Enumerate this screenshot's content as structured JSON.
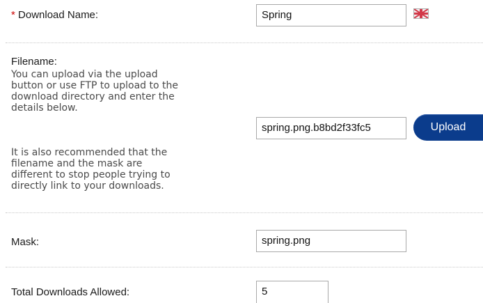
{
  "download_name": {
    "required_marker": "*",
    "label": "Download Name:",
    "value": "Spring",
    "language_icon": "uk-flag-icon"
  },
  "filename": {
    "label": "Filename:",
    "help_1_lines": [
      "You can upload via the upload",
      "button or use FTP to upload to the",
      "download directory and enter the",
      "details below."
    ],
    "help_2_lines": [
      "It is also recommended that the",
      "filename and the mask are",
      "different to stop people trying to",
      "directly link to your downloads."
    ],
    "value": "spring.png.b8bd2f33fc5",
    "upload_label": "Upload"
  },
  "mask": {
    "label": "Mask:",
    "value": "spring.png"
  },
  "total_downloads": {
    "label": "Total Downloads Allowed:",
    "value": "5"
  },
  "colors": {
    "required": "#cc0000",
    "button_bg": "#0b3c8c",
    "divider": "#c8c8c8",
    "help_text": "#4a4a4a"
  }
}
